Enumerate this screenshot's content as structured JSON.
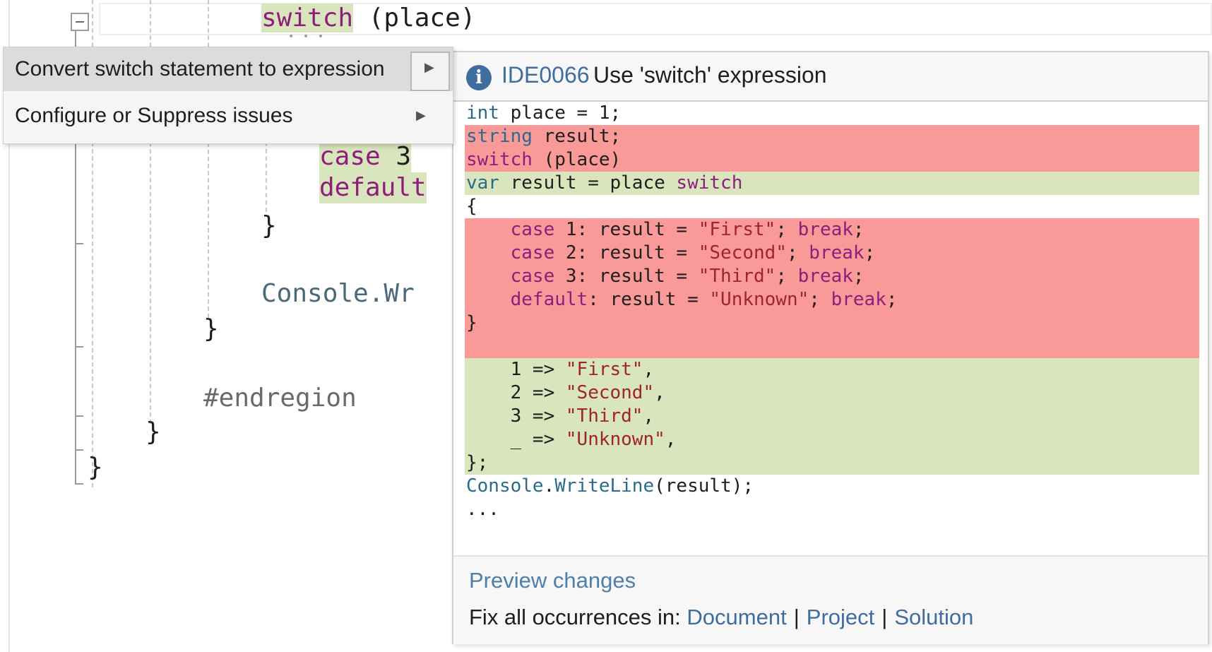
{
  "editor": {
    "lines": {
      "switch_kw": "switch",
      "switch_rest": " (place)",
      "case3_kw": "case",
      "case3_rest": " 3",
      "default_kw": "default",
      "close_brace_1": "}",
      "console_text": "Console.Wr",
      "close_brace_2": "}",
      "endregion": "#endregion",
      "close_brace_3": "}",
      "close_brace_4": "}"
    }
  },
  "menu": {
    "items": [
      {
        "label": "Convert switch statement to expression",
        "selected": true
      },
      {
        "label": "Configure or Suppress issues",
        "selected": false
      }
    ]
  },
  "preview": {
    "rule_id": "IDE0066",
    "rule_title": "Use 'switch' expression",
    "diff": [
      {
        "kind": "ctx",
        "parts": [
          [
            "t",
            "int"
          ],
          [
            "m",
            " place = 1;"
          ]
        ]
      },
      {
        "kind": "del",
        "parts": [
          [
            "t",
            "string"
          ],
          [
            "m",
            " result;"
          ]
        ]
      },
      {
        "kind": "del",
        "parts": [
          [
            "k",
            "switch"
          ],
          [
            "m",
            " (place)"
          ]
        ]
      },
      {
        "kind": "add",
        "parts": [
          [
            "t",
            "var"
          ],
          [
            "m",
            " result = place "
          ],
          [
            "k",
            "switch"
          ]
        ]
      },
      {
        "kind": "ctx",
        "parts": [
          [
            "m",
            "{"
          ]
        ]
      },
      {
        "kind": "del",
        "parts": [
          [
            "m",
            "    "
          ],
          [
            "k",
            "case"
          ],
          [
            "m",
            " 1: result = "
          ],
          [
            "s",
            "\"First\""
          ],
          [
            "m",
            "; "
          ],
          [
            "k",
            "break"
          ],
          [
            "m",
            ";"
          ]
        ]
      },
      {
        "kind": "del",
        "parts": [
          [
            "m",
            "    "
          ],
          [
            "k",
            "case"
          ],
          [
            "m",
            " 2: result = "
          ],
          [
            "s",
            "\"Second\""
          ],
          [
            "m",
            "; "
          ],
          [
            "k",
            "break"
          ],
          [
            "m",
            ";"
          ]
        ]
      },
      {
        "kind": "del",
        "parts": [
          [
            "m",
            "    "
          ],
          [
            "k",
            "case"
          ],
          [
            "m",
            " 3: result = "
          ],
          [
            "s",
            "\"Third\""
          ],
          [
            "m",
            "; "
          ],
          [
            "k",
            "break"
          ],
          [
            "m",
            ";"
          ]
        ]
      },
      {
        "kind": "del",
        "parts": [
          [
            "m",
            "    "
          ],
          [
            "k",
            "default"
          ],
          [
            "m",
            ": result = "
          ],
          [
            "s",
            "\"Unknown\""
          ],
          [
            "m",
            "; "
          ],
          [
            "k",
            "break"
          ],
          [
            "m",
            ";"
          ]
        ]
      },
      {
        "kind": "del",
        "parts": [
          [
            "m",
            "}"
          ]
        ]
      },
      {
        "kind": "del",
        "parts": [
          [
            "m",
            ""
          ]
        ]
      },
      {
        "kind": "add",
        "parts": [
          [
            "m",
            "    1 => "
          ],
          [
            "s",
            "\"First\""
          ],
          [
            "m",
            ","
          ]
        ]
      },
      {
        "kind": "add",
        "parts": [
          [
            "m",
            "    2 => "
          ],
          [
            "s",
            "\"Second\""
          ],
          [
            "m",
            ","
          ]
        ]
      },
      {
        "kind": "add",
        "parts": [
          [
            "m",
            "    3 => "
          ],
          [
            "s",
            "\"Third\""
          ],
          [
            "m",
            ","
          ]
        ]
      },
      {
        "kind": "add",
        "parts": [
          [
            "m",
            "    _ => "
          ],
          [
            "s",
            "\"Unknown\""
          ],
          [
            "m",
            ","
          ]
        ]
      },
      {
        "kind": "add",
        "parts": [
          [
            "m",
            "};"
          ]
        ]
      },
      {
        "kind": "ctx",
        "parts": [
          [
            "t",
            "Console"
          ],
          [
            "m",
            "."
          ],
          [
            "t",
            "WriteLine"
          ],
          [
            "m",
            "(result);"
          ]
        ]
      },
      {
        "kind": "ctx",
        "parts": [
          [
            "m",
            "..."
          ]
        ]
      }
    ],
    "preview_changes": "Preview changes",
    "fix_all_label": "Fix all occurrences in:",
    "fix_all_targets": [
      "Document",
      "Project",
      "Solution"
    ],
    "separator": "|"
  },
  "colors": {
    "keyword": "#8f1d7c",
    "type": "#2a6b8a",
    "string": "#a0242b",
    "deleted_bg": "#f99a99",
    "added_bg": "#d8e5bd",
    "link": "#3f6d9e"
  }
}
